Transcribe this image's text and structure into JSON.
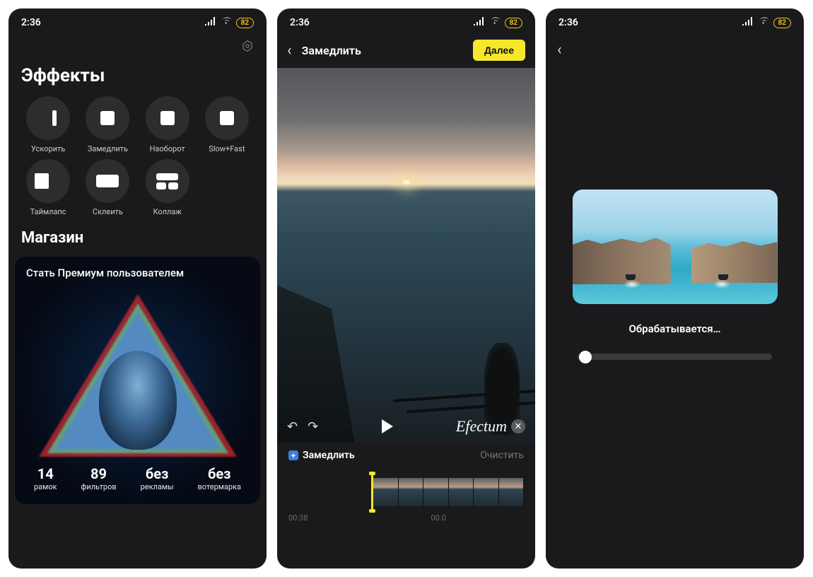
{
  "status": {
    "time": "2:36",
    "battery_label": "82"
  },
  "screen1": {
    "effects_title": "Эффекты",
    "effects": [
      {
        "label": "Ускорить"
      },
      {
        "label": "Замедлить"
      },
      {
        "label": "Наоборот"
      },
      {
        "label": "Slow+Fast"
      },
      {
        "label": "Таймлапс"
      },
      {
        "label": "Склеить"
      },
      {
        "label": "Коллаж"
      }
    ],
    "shop_title": "Магазин",
    "premium": {
      "title": "Стать Премиум пользователем",
      "stats": [
        {
          "val": "14",
          "lbl": "рамок"
        },
        {
          "val": "89",
          "lbl": "фильтров"
        },
        {
          "val": "без",
          "lbl": "рекламы"
        },
        {
          "val": "без",
          "lbl": "вотермарка"
        }
      ]
    }
  },
  "screen2": {
    "title": "Замедлить",
    "next": "Далее",
    "watermark": "Efectum",
    "action_label": "Замедлить",
    "clear": "Очистить",
    "time_left": "00:38",
    "time_mid": "00.0"
  },
  "screen3": {
    "processing": "Обрабатывается…"
  }
}
